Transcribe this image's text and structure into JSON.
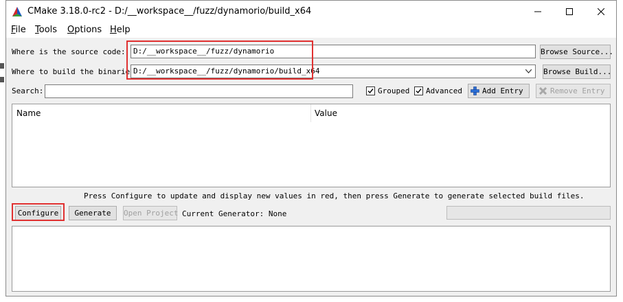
{
  "window": {
    "title": "CMake 3.18.0-rc2 - D:/__workspace__/fuzz/dynamorio/build_x64"
  },
  "menu": {
    "items": [
      "File",
      "Tools",
      "Options",
      "Help"
    ]
  },
  "paths": {
    "source_label": "Where is the source code:",
    "source_value": "D:/__workspace__/fuzz/dynamorio",
    "browse_source": "Browse Source...",
    "build_label": "Where to build the binaries:",
    "build_value": "D:/__workspace__/fuzz/dynamorio/build_x64",
    "browse_build": "Browse Build..."
  },
  "search": {
    "label": "Search:",
    "value": "",
    "grouped_label": "Grouped",
    "grouped_checked": true,
    "advanced_label": "Advanced",
    "advanced_checked": true,
    "add_entry": "Add Entry",
    "remove_entry": "Remove Entry"
  },
  "table": {
    "columns": [
      "Name",
      "Value"
    ],
    "rows": []
  },
  "hint": "Press Configure to update and display new values in red, then press Generate to generate selected build files.",
  "actions": {
    "configure": "Configure",
    "generate": "Generate",
    "open_project": "Open Project",
    "generator": "Current Generator: None"
  },
  "colors": {
    "highlight": "#e03030",
    "accent_blue": "#2b6fd6"
  }
}
